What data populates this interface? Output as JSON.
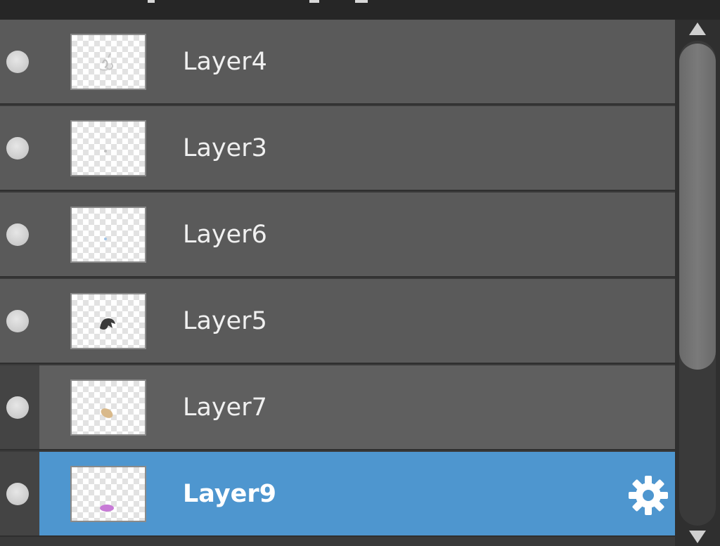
{
  "layers_panel": {
    "layers": [
      {
        "name": "Layer4",
        "selected": false,
        "child": false,
        "thumb": "sketch-gray"
      },
      {
        "name": "Layer3",
        "selected": false,
        "child": false,
        "thumb": "dot-gray"
      },
      {
        "name": "Layer6",
        "selected": false,
        "child": false,
        "thumb": "dot-blue"
      },
      {
        "name": "Layer5",
        "selected": false,
        "child": false,
        "thumb": "shape-dark"
      },
      {
        "name": "Layer7",
        "selected": false,
        "child": true,
        "thumb": "blob-tan"
      },
      {
        "name": "Layer9",
        "selected": true,
        "child": true,
        "thumb": "blob-purple"
      }
    ],
    "selected_icon": "gear-icon",
    "visibility_icon": "circle-dot-icon",
    "colors": {
      "row": "#5a5a5a",
      "selected": "#4e96cf",
      "text": "#f0f0f0",
      "background": "#333333"
    }
  },
  "scrollbar": {
    "up_icon": "triangle-up-icon",
    "down_icon": "triangle-down-icon"
  }
}
